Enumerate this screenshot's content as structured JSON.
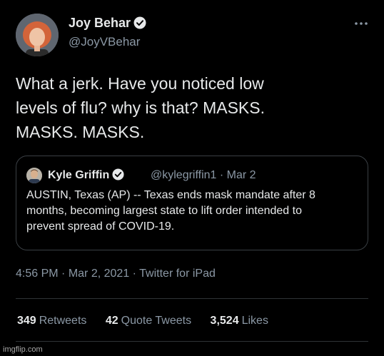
{
  "tweet": {
    "author_name": "Joy Behar",
    "author_handle": "@JoyVBehar",
    "text_lines": [
      "What a jerk. Have you noticed low",
      "levels of flu? why is that? MASKS.",
      "MASKS. MASKS."
    ],
    "time": "4:56 PM",
    "date": "Mar 2, 2021",
    "source": "Twitter for iPad",
    "separator": "·"
  },
  "quoted": {
    "author_name": "Kyle Griffin",
    "author_handle": "@kylegriffin1",
    "date": "Mar 2",
    "meta": "@kylegriffin1 · Mar 2",
    "text_lines": [
      "AUSTIN, Texas (AP) -- Texas ends mask mandate after 8",
      "months, becoming largest state to lift order intended to",
      "prevent spread of COVID-19."
    ]
  },
  "stats": {
    "retweets_count": "349",
    "retweets_label": "Retweets",
    "quotes_count": "42",
    "quotes_label": "Quote Tweets",
    "likes_count": "3,524",
    "likes_label": "Likes"
  },
  "icons": {
    "verified": "verified-check-icon",
    "more": "more-dots-icon"
  },
  "colors": {
    "background": "#000000",
    "text_primary": "#e7e9ea",
    "text_secondary": "#8b98a5",
    "border": "#2f3336"
  },
  "watermark": "imgflip.com"
}
